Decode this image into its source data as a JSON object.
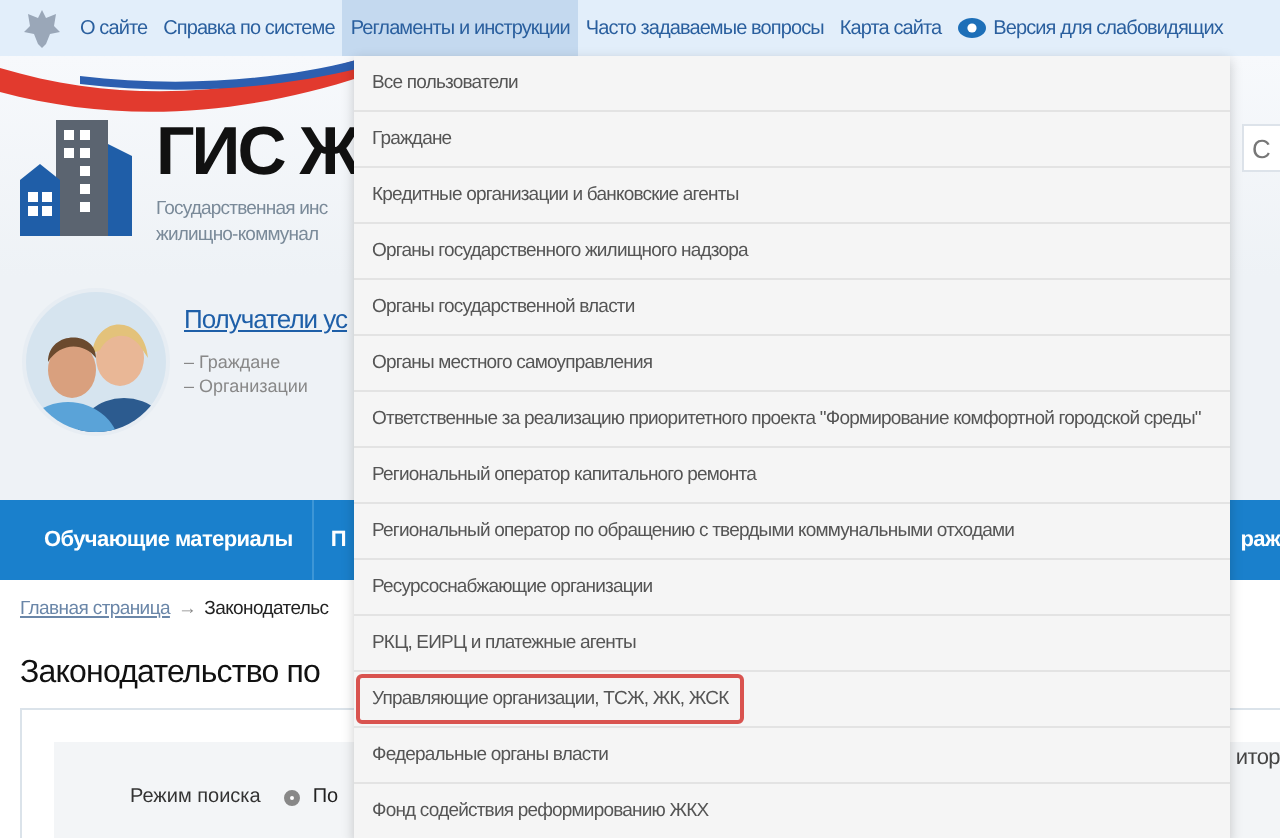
{
  "top_nav": {
    "items": [
      {
        "label": "О сайте",
        "selected": false,
        "kind": "link"
      },
      {
        "label": "Справка по системе",
        "selected": false,
        "kind": "link"
      },
      {
        "label": "Регламенты и инструкции",
        "selected": true,
        "kind": "link"
      },
      {
        "label": "Часто задаваемые вопросы",
        "selected": false,
        "kind": "link"
      },
      {
        "label": "Карта сайта",
        "selected": false,
        "kind": "link"
      },
      {
        "label": "Версия для слабовидящих",
        "selected": false,
        "kind": "accessibility"
      }
    ]
  },
  "header": {
    "title": "ГИС Ж",
    "subtitle_lines": [
      "Государственная инс",
      "жилищно-коммунал"
    ],
    "search_field": {
      "placeholder": "С"
    }
  },
  "audience": {
    "link": "Получатели ус",
    "items": [
      "– Граждане",
      "– Организации"
    ]
  },
  "main_nav": {
    "items": [
      "Обучающие материалы",
      "П"
    ],
    "right_item": "раж"
  },
  "breadcrumb": {
    "link": "Главная страница",
    "separator": "→",
    "current": "Законодательс"
  },
  "heading": "Законодательство по",
  "search_panel": {
    "mode_label": "Режим поиска",
    "mode_option": {
      "label": "По",
      "selected": true
    },
    "side_text": "итор"
  },
  "dropdown": {
    "items": [
      {
        "label": "Все пользователи",
        "highlighted": false
      },
      {
        "label": "Граждане",
        "highlighted": false
      },
      {
        "label": "Кредитные организации и банковские агенты",
        "highlighted": false
      },
      {
        "label": "Органы государственного жилищного надзора",
        "highlighted": false
      },
      {
        "label": "Органы государственной власти",
        "highlighted": false
      },
      {
        "label": "Органы местного самоуправления",
        "highlighted": false
      },
      {
        "label": "Ответственные за реализацию приоритетного проекта \"Формирование комфортной городской среды\"",
        "highlighted": false
      },
      {
        "label": "Региональный оператор капитального ремонта",
        "highlighted": false
      },
      {
        "label": "Региональный оператор по обращению с твердыми коммунальными отходами",
        "highlighted": false
      },
      {
        "label": "Ресурсоснабжающие организации",
        "highlighted": false
      },
      {
        "label": "РКЦ, ЕИРЦ и платежные агенты",
        "highlighted": false
      },
      {
        "label": "Управляющие организации, ТСЖ, ЖК, ЖСК",
        "highlighted": true
      },
      {
        "label": "Федеральные органы власти",
        "highlighted": false
      },
      {
        "label": "Фонд содействия реформированию ЖКХ",
        "highlighted": false
      }
    ]
  }
}
